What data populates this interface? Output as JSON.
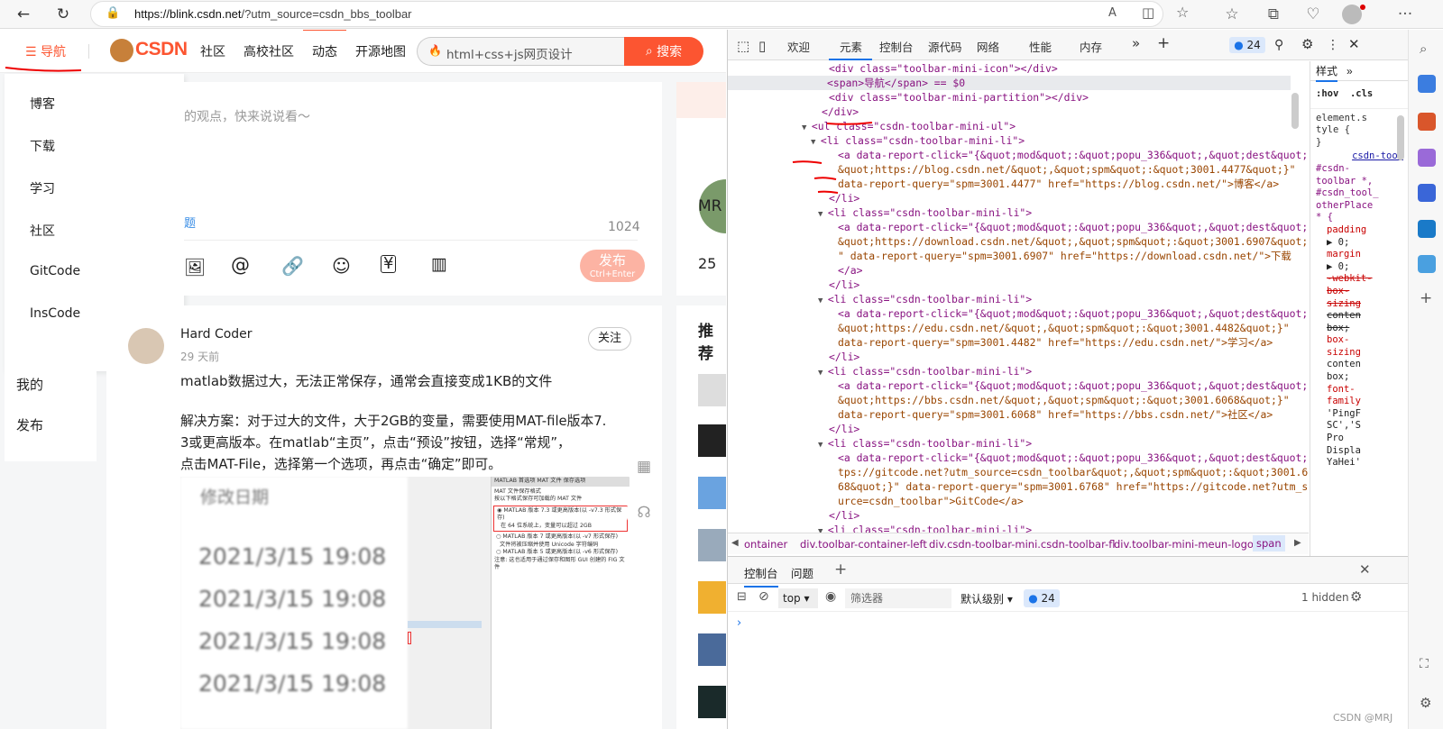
{
  "browser": {
    "url_host": "https://blink.csdn.net",
    "url_rest": "/?utm_source=csdn_bbs_toolbar"
  },
  "csdn": {
    "nav_label": "导航",
    "logo": "CSDN",
    "topnav": [
      "社区",
      "高校社区",
      "动态",
      "开源地图"
    ],
    "search_placeholder": "html+css+js网页设计",
    "search_btn": "搜索",
    "menu": [
      "博客",
      "下载",
      "学习",
      "社区",
      "GitCode",
      "InsCode"
    ],
    "menu2": [
      "我的",
      "发布"
    ],
    "compose_placeholder": "的观点，快来说说看～",
    "topic": "题",
    "count": "1024",
    "publish": "发布",
    "publish_sub": "Ctrl+Enter",
    "post": {
      "author": "Hard Coder",
      "time": "29 天前",
      "follow": "关注",
      "title": "matlab数据过大，无法正常保存，通常会直接变成1KB的文件",
      "body1": "解决方案：对于过大的文件，大于2GB的变量，需要使用MAT-file版本7.",
      "body2": "3或更高版本。在matlab“主页”，点击“预设”按钮，选择“常规”，",
      "body3": "点击MAT-File，选择第一个选项，再点击“确定”即可。",
      "img_head": "修改日期",
      "img_dates": [
        "2021/3/15 19:08",
        "2021/3/15 19:08",
        "2021/3/15 19:08",
        "2021/3/15 19:08"
      ],
      "mat_title": "MATLAB 首选项  MAT 文件 保存选项",
      "mat_sub": "MAT 文件保存格式",
      "mat_q": "按以下格式保存可加载的 MAT 文件",
      "mat_o1": "MATLAB 版本 7.3 或更高版本(以 -v7.3 形式保存)",
      "mat_o1b": "在 64 位系统上，变量可以超过 2GB",
      "mat_o2": "MATLAB 版本 7 或更高版本(以 -v7 形式保存)",
      "mat_o2b": "文件将被压缩并使用 Unicode 字符编码",
      "mat_o3": "MATLAB 版本 5 或更高版本(以 -v6 形式保存)",
      "mat_note": "注意: 这也适用于通过保存和图形 GUI 创建的 FIG 文件"
    },
    "right": {
      "name": "MR",
      "num": "25",
      "heading": "推荐"
    }
  },
  "devtools": {
    "tabs": [
      "欢迎",
      "元素",
      "控制台",
      "源代码",
      "网络",
      "性能",
      "内存"
    ],
    "badge": "24",
    "lines": [
      "<div class=\"toolbar-mini-icon\"></div>",
      "<span>导航</span>  == $0",
      "<div class=\"toolbar-mini-partition\"></div>",
      "</div>",
      "<ul class=\"csdn-toolbar-mini-ul\">",
      "<li class=\"csdn-toolbar-mini-li\">",
      "<a data-report-click=\"{&quot;mod&quot;:&quot;popu_336&quot;,&quot;dest&quot;:",
      "&quot;https://blog.csdn.net/&quot;,&quot;spm&quot;:&quot;3001.4477&quot;}\"",
      "data-report-query=\"spm=3001.4477\" href=\"https://blog.csdn.net/\">博客</a>",
      "</li>",
      "<li class=\"csdn-toolbar-mini-li\">",
      "<a data-report-click=\"{&quot;mod&quot;:&quot;popu_336&quot;,&quot;dest&quot;:",
      "&quot;https://download.csdn.net/&quot;,&quot;spm&quot;:&quot;3001.6907&quot;}",
      "\" data-report-query=\"spm=3001.6907\" href=\"https://download.csdn.net/\">下载",
      "</a>",
      "</li>",
      "<li class=\"csdn-toolbar-mini-li\">",
      "<a data-report-click=\"{&quot;mod&quot;:&quot;popu_336&quot;,&quot;dest&quot;:",
      "&quot;https://edu.csdn.net/&quot;,&quot;spm&quot;:&quot;3001.4482&quot;}\"",
      "data-report-query=\"spm=3001.4482\" href=\"https://edu.csdn.net/\">学习</a>",
      "</li>",
      "<li class=\"csdn-toolbar-mini-li\">",
      "<a data-report-click=\"{&quot;mod&quot;:&quot;popu_336&quot;,&quot;dest&quot;:",
      "&quot;https://bbs.csdn.net/&quot;,&quot;spm&quot;:&quot;3001.6068&quot;}\"",
      "data-report-query=\"spm=3001.6068\" href=\"https://bbs.csdn.net/\">社区</a>",
      "</li>",
      "<li class=\"csdn-toolbar-mini-li\">",
      "<a data-report-click=\"{&quot;mod&quot;:&quot;popu_336&quot;,&quot;dest&quot;:&quot;ht",
      "tps://gitcode.net?utm_source=csdn_toolbar&quot;,&quot;spm&quot;:&quot;3001.67",
      "68&quot;}\" data-report-query=\"spm=3001.6768\" href=\"https://gitcode.net?utm_so",
      "urce=csdn_toolbar\">GitCode</a>",
      "</li>",
      "<li class=\"csdn-toolbar-mini-li\">"
    ],
    "styles": {
      "tab": "样式",
      "hov": ":hov",
      "cls": ".cls",
      "rule1": "element.s",
      "rule1b": "tyle {",
      "rule1c": "}",
      "link": "csdn-too…",
      "sel": [
        "#csdn-",
        "toolbar *,",
        "#csdn_tool_",
        "otherPlace",
        "* {"
      ],
      "props": [
        "padding",
        "▶ 0;",
        "margin",
        "▶ 0;",
        "-webkit-",
        "box-",
        "sizing",
        "conten",
        "box;",
        "box-",
        "sizing",
        "conten",
        "box;",
        "font-",
        "family",
        "'PingF",
        "SC','S",
        "Pro",
        "Displa",
        "YaHei'"
      ]
    },
    "breadcrumbs": [
      "ontainer",
      "div.toolbar-container-left",
      "div.csdn-toolbar-mini.csdn-toolbar-fl",
      "div.toolbar-mini-meun-logo",
      "span"
    ],
    "console": {
      "tabs": [
        "控制台",
        "问题"
      ],
      "context": "top",
      "filter": "筛选器",
      "level": "默认级别",
      "badge": "24",
      "hidden": "1 hidden"
    }
  },
  "watermark": "CSDN @MRJ"
}
